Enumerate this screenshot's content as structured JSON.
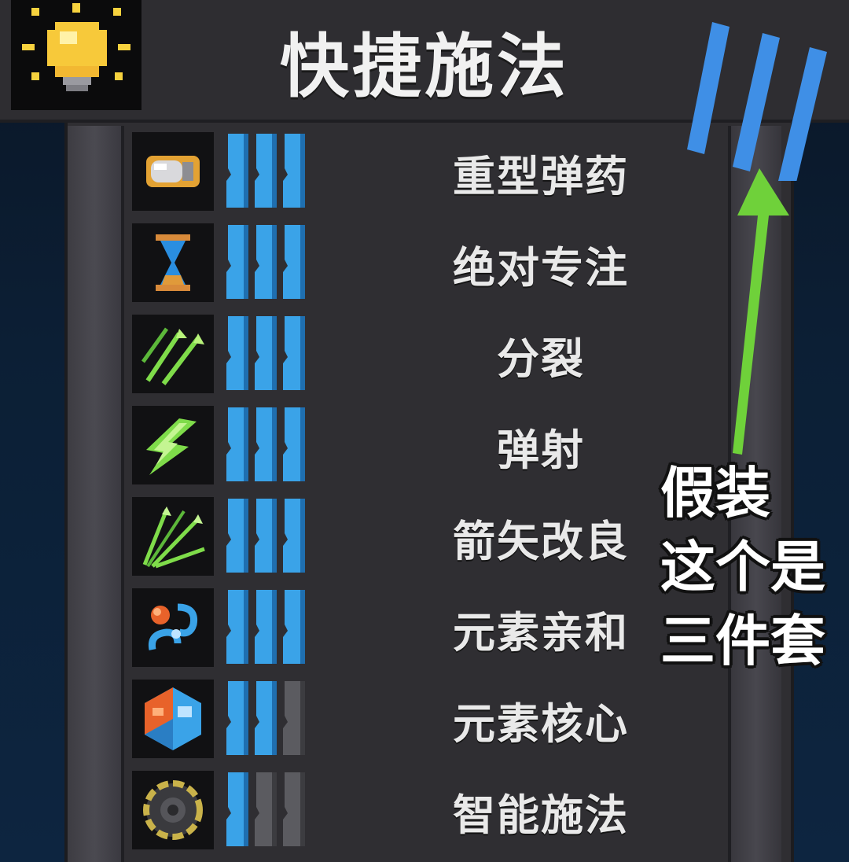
{
  "header": {
    "title": "快捷施法",
    "icon": "lightbulb-icon"
  },
  "skills": [
    {
      "label": "重型弹药",
      "icon": "heavy-ammo-icon",
      "level": 3,
      "max": 3
    },
    {
      "label": "绝对专注",
      "icon": "hourglass-icon",
      "level": 3,
      "max": 3
    },
    {
      "label": "分裂",
      "icon": "split-arrows-icon",
      "level": 3,
      "max": 3
    },
    {
      "label": "弹射",
      "icon": "ricochet-icon",
      "level": 3,
      "max": 3
    },
    {
      "label": "箭矢改良",
      "icon": "arrow-upgrade-icon",
      "level": 3,
      "max": 3
    },
    {
      "label": "元素亲和",
      "icon": "element-affinity-icon",
      "level": 3,
      "max": 3
    },
    {
      "label": "元素核心",
      "icon": "element-core-icon",
      "level": 2,
      "max": 3
    },
    {
      "label": "智能施法",
      "icon": "smart-cast-gear-icon",
      "level": 1,
      "max": 3
    }
  ],
  "annotation": {
    "lines": [
      "假装",
      "这个是",
      "三件套"
    ],
    "arrow_color": "#6fd13a",
    "marks_color": "#3f8fe6"
  },
  "colors": {
    "pip_filled": "#3aa3e8",
    "pip_empty": "#5b5b60",
    "panel": "#2f2e32"
  }
}
